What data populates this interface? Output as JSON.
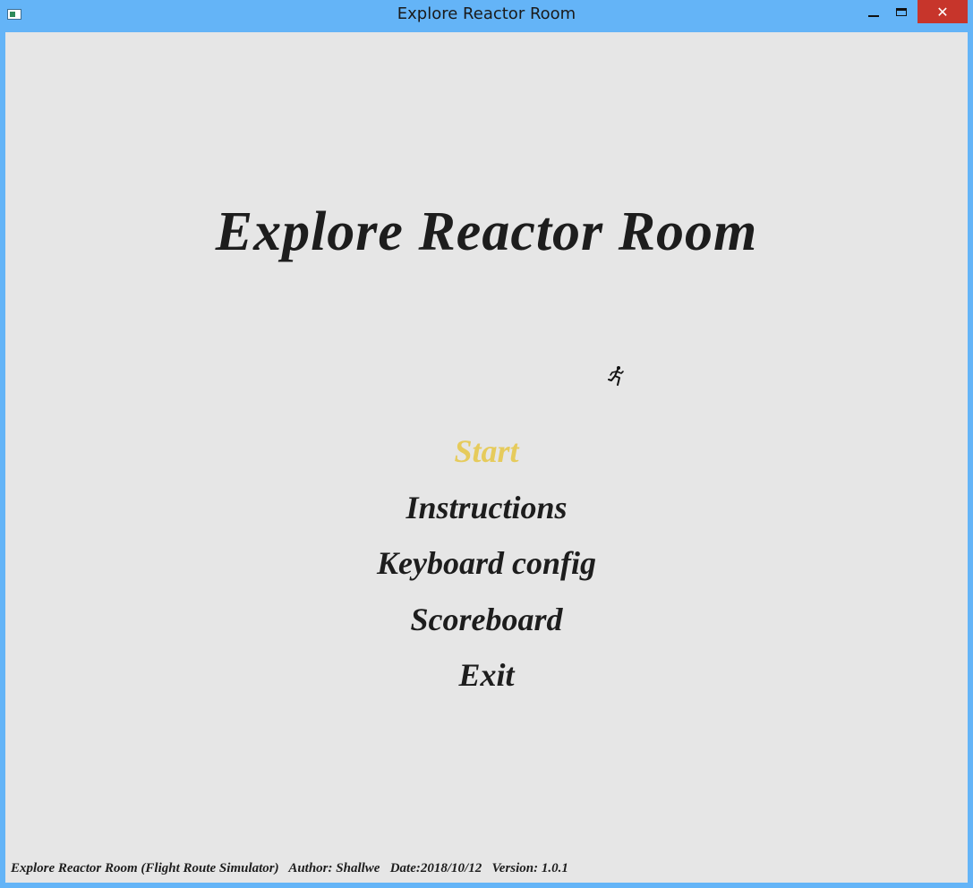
{
  "window": {
    "title": "Explore Reactor Room",
    "close_glyph": "✕"
  },
  "game": {
    "title": "Explore Reactor Room",
    "menu": [
      {
        "label": "Start",
        "selected": true
      },
      {
        "label": "Instructions",
        "selected": false
      },
      {
        "label": "Keyboard config",
        "selected": false
      },
      {
        "label": "Scoreboard",
        "selected": false
      },
      {
        "label": "Exit",
        "selected": false
      }
    ],
    "footer": {
      "app": "Explore Reactor Room (Flight Route Simulator)",
      "author": "Author: Shallwe",
      "date": "Date:2018/10/12",
      "version": "Version: 1.0.1"
    }
  },
  "colors": {
    "titlebar": "#64b4f7",
    "background": "#e6e6e6",
    "text": "#1d1d1d",
    "selected": "#e6cb5c",
    "close_button": "#c7352b"
  },
  "icons": {
    "app": "app-window-icon",
    "cursor": "running-man-icon"
  }
}
